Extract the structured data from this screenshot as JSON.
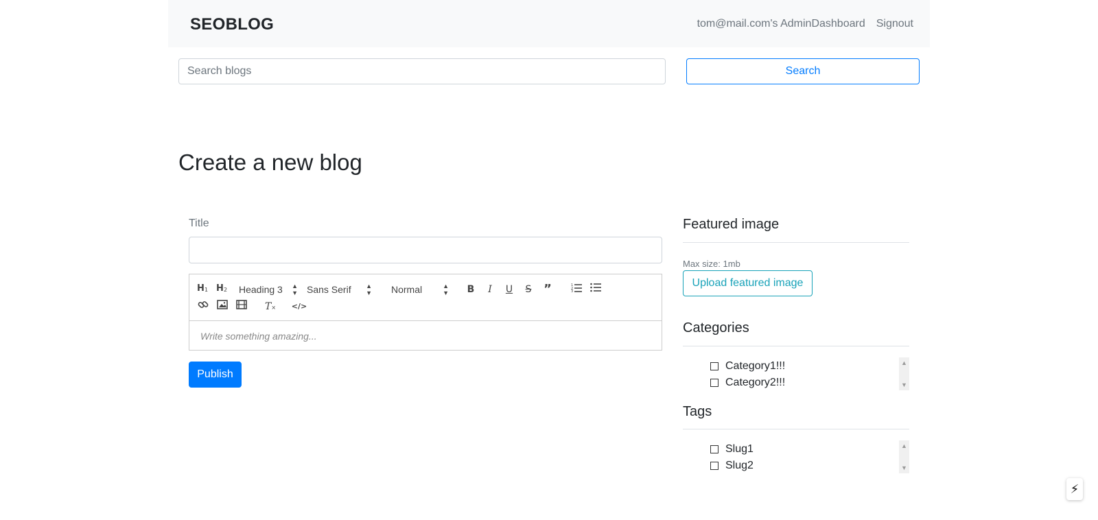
{
  "navbar": {
    "brand": "SEOBLOG",
    "links": [
      "tom@mail.com's AdminDashboard",
      "Signout"
    ]
  },
  "search": {
    "placeholder": "Search blogs",
    "button_label": "Search"
  },
  "page": {
    "title": "Create a new blog"
  },
  "form": {
    "title_label": "Title",
    "title_value": "",
    "editor": {
      "header_picker": "Heading 3",
      "font_picker": "Sans Serif",
      "size_picker": "Normal",
      "placeholder": "Write something amazing...",
      "icons": [
        "h1-icon",
        "h2-icon",
        "bold-icon",
        "italic-icon",
        "underline-icon",
        "strikethrough-icon",
        "blockquote-icon",
        "ordered-list-icon",
        "bullet-list-icon",
        "link-icon",
        "image-icon",
        "video-icon",
        "clear-format-icon",
        "code-block-icon"
      ]
    },
    "publish_label": "Publish"
  },
  "sidebar": {
    "featured": {
      "heading": "Featured image",
      "max_size": "Max size: 1mb",
      "upload_label": "Upload featured image"
    },
    "categories": {
      "heading": "Categories",
      "items": [
        "Category1!!!",
        "Category2!!!"
      ]
    },
    "tags": {
      "heading": "Tags",
      "items": [
        "Slug1",
        "Slug2"
      ]
    }
  },
  "colors": {
    "primary": "#007bff",
    "info": "#17a2b8",
    "navbar_bg": "#f8f9fa",
    "muted": "#6c757d"
  }
}
